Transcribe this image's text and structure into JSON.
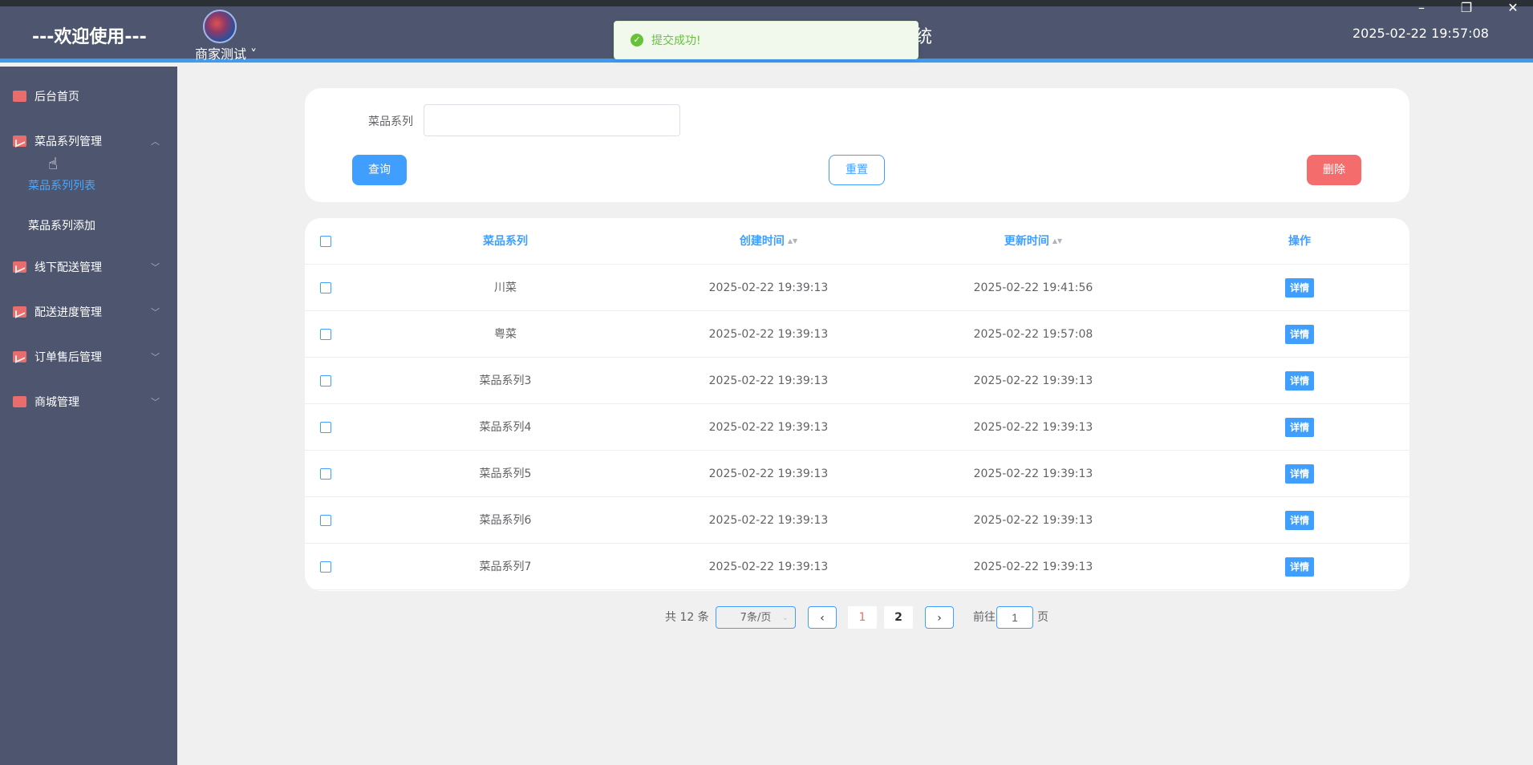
{
  "header": {
    "welcome": "---欢迎使用---",
    "user_name": "商家测试",
    "user_menu_caret": "˅",
    "system_title_partial": "统",
    "clock": "2025-02-22 19:57:08"
  },
  "window_controls": {
    "minimize": "–",
    "restore": "❐",
    "close": "✕"
  },
  "toast": {
    "icon": "✓",
    "message": "提交成功!"
  },
  "sidebar": {
    "items": [
      {
        "label": "后台首页",
        "icon": "monitor-icon"
      },
      {
        "label": "菜品系列管理",
        "icon": "chart-icon",
        "chevron": "︿"
      },
      {
        "label": "线下配送管理",
        "icon": "chart-icon",
        "chevron": "﹀"
      },
      {
        "label": "配送进度管理",
        "icon": "chart-icon",
        "chevron": "﹀"
      },
      {
        "label": "订单售后管理",
        "icon": "chart-icon",
        "chevron": "﹀"
      },
      {
        "label": "商城管理",
        "icon": "monitor-icon",
        "chevron": "﹀"
      }
    ],
    "submenu": [
      {
        "label": "菜品系列列表",
        "active": true
      },
      {
        "label": "菜品系列添加",
        "active": false
      }
    ]
  },
  "search": {
    "label": "菜品系列",
    "value": "",
    "query_label": "查询",
    "reset_label": "重置",
    "delete_label": "删除"
  },
  "table": {
    "columns": [
      "菜品系列",
      "创建时间",
      "更新时间",
      "操作"
    ],
    "sort_glyph": "▲▼",
    "detail_label": "详情",
    "rows": [
      {
        "series": "川菜",
        "created": "2025-02-22 19:39:13",
        "updated": "2025-02-22 19:41:56"
      },
      {
        "series": "粤菜",
        "created": "2025-02-22 19:39:13",
        "updated": "2025-02-22 19:57:08"
      },
      {
        "series": "菜品系列3",
        "created": "2025-02-22 19:39:13",
        "updated": "2025-02-22 19:39:13"
      },
      {
        "series": "菜品系列4",
        "created": "2025-02-22 19:39:13",
        "updated": "2025-02-22 19:39:13"
      },
      {
        "series": "菜品系列5",
        "created": "2025-02-22 19:39:13",
        "updated": "2025-02-22 19:39:13"
      },
      {
        "series": "菜品系列6",
        "created": "2025-02-22 19:39:13",
        "updated": "2025-02-22 19:39:13"
      },
      {
        "series": "菜品系列7",
        "created": "2025-02-22 19:39:13",
        "updated": "2025-02-22 19:39:13"
      }
    ]
  },
  "pagination": {
    "total": "共 12 条",
    "page_size": "7条/页",
    "size_arrow": "⌄",
    "prev": "‹",
    "next": "›",
    "pages": [
      "1",
      "2"
    ],
    "current": "1",
    "goto_label": "前往",
    "jump_value": "1",
    "page_suffix": "页"
  },
  "colors": {
    "sidebar": "#4d566e",
    "accent": "#409eff",
    "danger": "#f56c6c",
    "success": "#67c23a",
    "menu_icon": "#e96d6d"
  }
}
